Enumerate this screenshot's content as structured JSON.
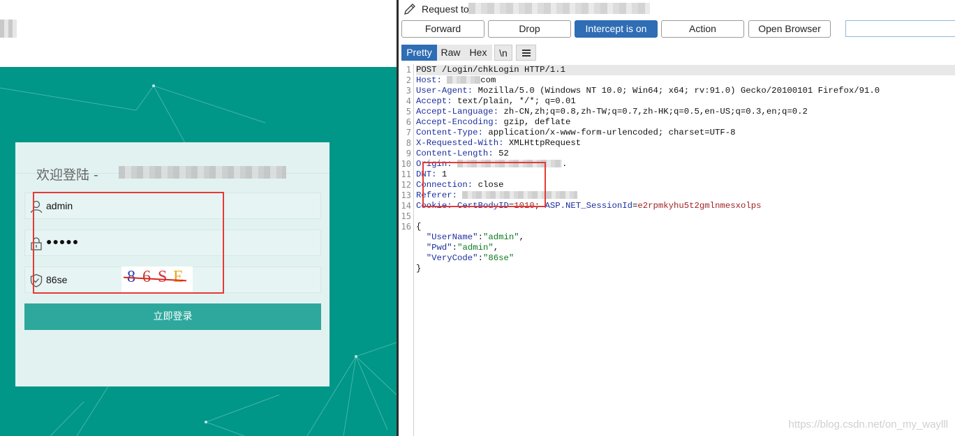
{
  "login": {
    "title": "欢迎登陆 -",
    "username": "admin",
    "password_mask": "●●●●●",
    "captcha_input": "86se",
    "captcha_chars": [
      {
        "ch": "8",
        "color": "#2b3fa8"
      },
      {
        "ch": "6",
        "color": "#c0392b"
      },
      {
        "ch": "S",
        "color": "#d63031"
      },
      {
        "ch": "E",
        "color": "#e6a817"
      }
    ],
    "submit_label": "立即登录"
  },
  "burp": {
    "request_title": "Request to",
    "buttons": {
      "forward": "Forward",
      "drop": "Drop",
      "intercept": "Intercept is on",
      "action": "Action",
      "open_browser": "Open Browser"
    },
    "tabs": {
      "pretty": "Pretty",
      "raw": "Raw",
      "hex": "Hex",
      "newline": "\\n"
    },
    "line_numbers": [
      "1",
      "2",
      "3",
      "4",
      "5",
      "6",
      "7",
      "8",
      "9",
      "10",
      "11",
      "12",
      "13",
      "14",
      "15",
      "16"
    ],
    "request_line": "POST /Login/chkLogin HTTP/1.1",
    "headers": [
      {
        "key": "Host",
        "value": "com"
      },
      {
        "key": "User-Agent",
        "value": "Mozilla/5.0 (Windows NT 10.0; Win64; x64; rv:91.0) Gecko/20100101 Firefox/91.0"
      },
      {
        "key": "Accept",
        "value": "text/plain, */*; q=0.01"
      },
      {
        "key": "Accept-Language",
        "value": "zh-CN,zh;q=0.8,zh-TW;q=0.7,zh-HK;q=0.5,en-US;q=0.3,en;q=0.2"
      },
      {
        "key": "Accept-Encoding",
        "value": "gzip, deflate"
      },
      {
        "key": "Content-Type",
        "value": "application/x-www-form-urlencoded; charset=UTF-8"
      },
      {
        "key": "X-Requested-With",
        "value": "XMLHttpRequest"
      },
      {
        "key": "Content-Length",
        "value": "52"
      },
      {
        "key": "Origin",
        "value": "."
      },
      {
        "key": "DNT",
        "value": "1"
      },
      {
        "key": "Connection",
        "value": "close"
      },
      {
        "key": "Referer",
        "value": ""
      }
    ],
    "cookie": {
      "key": "Cookie",
      "name1": "CertBodyID",
      "value1": "1010",
      "name2": "ASP.NET_SessionId",
      "value2": "e2rpmkyhu5t2gmlnmesxolps"
    },
    "body": {
      "open": "{",
      "fields": [
        {
          "key": "\"UserName\"",
          "value": "\"admin\"",
          "sep": ","
        },
        {
          "key": "\"Pwd\"",
          "value": "\"admin\"",
          "sep": ","
        },
        {
          "key": "\"VeryCode\"",
          "value": "\"86se\"",
          "sep": ""
        }
      ],
      "close": "}"
    }
  },
  "watermark": "https://blog.csdn.net/on_my_waylll"
}
